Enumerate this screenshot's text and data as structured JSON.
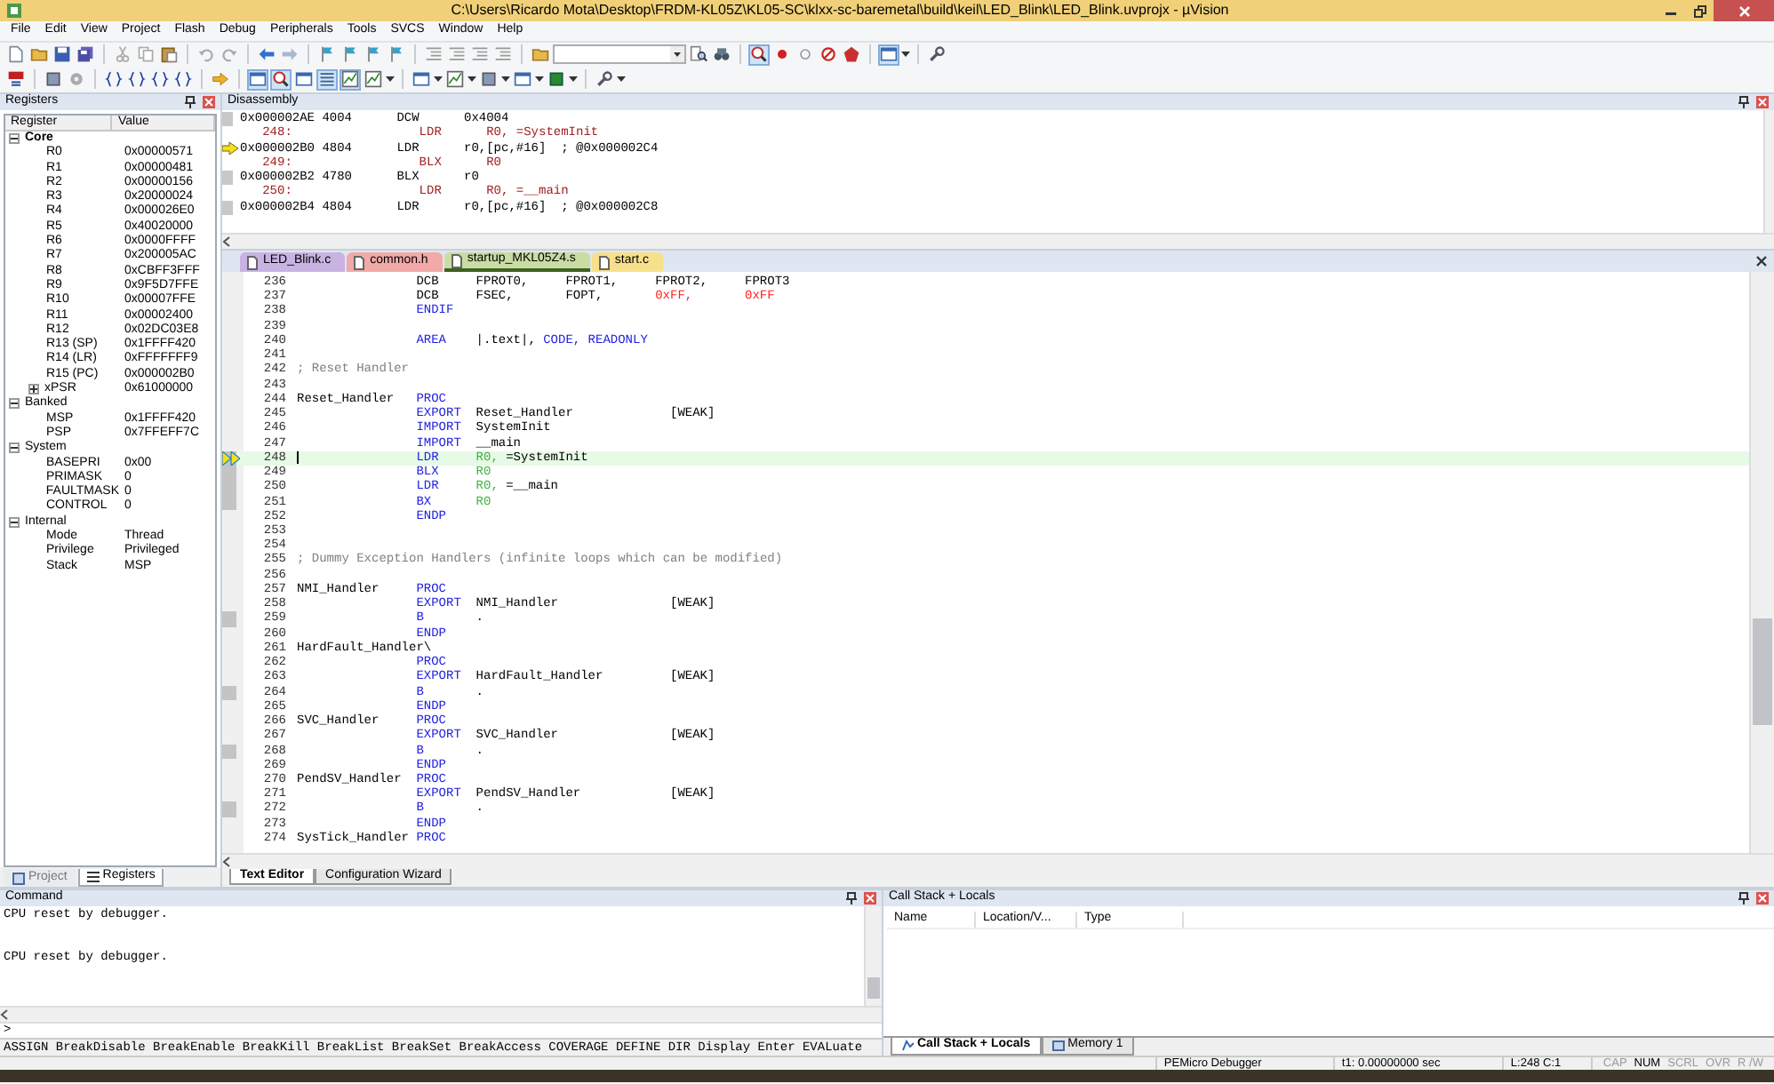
{
  "window": {
    "title": "C:\\Users\\Ricardo Mota\\Desktop\\FRDM-KL05Z\\KL05-SC\\klxx-sc-baremetal\\build\\keil\\LED_Blink\\LED_Blink.uvprojx - µVision"
  },
  "menu": [
    "File",
    "Edit",
    "View",
    "Project",
    "Flash",
    "Debug",
    "Peripherals",
    "Tools",
    "SVCS",
    "Window",
    "Help"
  ],
  "toolbars": [
    [
      {
        "kind": "document",
        "pressed": false
      },
      {
        "kind": "folder",
        "pressed": false
      },
      {
        "kind": "disk",
        "pressed": false
      },
      {
        "kind": "disks",
        "pressed": false
      },
      {
        "kind": "sep"
      },
      {
        "kind": "scissors",
        "pressed": false
      },
      {
        "kind": "copy",
        "pressed": false
      },
      {
        "kind": "paste",
        "pressed": false
      },
      {
        "kind": "sep"
      },
      {
        "kind": "undo",
        "pressed": false
      },
      {
        "kind": "redo",
        "pressed": false
      },
      {
        "kind": "sep"
      },
      {
        "kind": "back",
        "pressed": false
      },
      {
        "kind": "forward",
        "pressed": false
      },
      {
        "kind": "sep"
      },
      {
        "kind": "flag",
        "pressed": false
      },
      {
        "kind": "flag",
        "pressed": false
      },
      {
        "kind": "flag",
        "pressed": false
      },
      {
        "kind": "flag",
        "pressed": false
      },
      {
        "kind": "sep"
      },
      {
        "kind": "indent",
        "pressed": false
      },
      {
        "kind": "indent",
        "pressed": false
      },
      {
        "kind": "indent",
        "pressed": false
      },
      {
        "kind": "indent",
        "pressed": false
      },
      {
        "kind": "sep"
      },
      {
        "kind": "folder",
        "pressed": false
      },
      {
        "kind": "combo"
      },
      {
        "kind": "find",
        "pressed": false
      },
      {
        "kind": "binoculars",
        "pressed": false
      },
      {
        "kind": "sep"
      },
      {
        "kind": "magnifier",
        "pressed": true
      },
      {
        "kind": "dot",
        "pressed": false
      },
      {
        "kind": "circle",
        "pressed": false
      },
      {
        "kind": "crossed",
        "pressed": false
      },
      {
        "kind": "polygon",
        "pressed": false
      },
      {
        "kind": "sep"
      },
      {
        "kind": "window",
        "pressed": true
      },
      {
        "kind": "caret"
      },
      {
        "kind": "sep"
      },
      {
        "kind": "wrench",
        "pressed": false
      }
    ],
    [
      {
        "kind": "reset",
        "pressed": false
      },
      {
        "kind": "sep"
      },
      {
        "kind": "chip",
        "pressed": false
      },
      {
        "kind": "gear",
        "pressed": false
      },
      {
        "kind": "sep"
      },
      {
        "kind": "braces",
        "pressed": false
      },
      {
        "kind": "braces",
        "pressed": false
      },
      {
        "kind": "braces",
        "pressed": false
      },
      {
        "kind": "braces",
        "pressed": false
      },
      {
        "kind": "sep"
      },
      {
        "kind": "arrow",
        "pressed": false
      },
      {
        "kind": "sep"
      },
      {
        "kind": "window",
        "pressed": true
      },
      {
        "kind": "magnifier",
        "pressed": true
      },
      {
        "kind": "window",
        "pressed": false
      },
      {
        "kind": "list",
        "pressed": true
      },
      {
        "kind": "chart",
        "pressed": true
      },
      {
        "kind": "chart",
        "pressed": false
      },
      {
        "kind": "caret"
      },
      {
        "kind": "sep"
      },
      {
        "kind": "window",
        "pressed": false
      },
      {
        "kind": "caret"
      },
      {
        "kind": "chart",
        "pressed": false
      },
      {
        "kind": "caret"
      },
      {
        "kind": "chip",
        "pressed": false
      },
      {
        "kind": "caret"
      },
      {
        "kind": "window",
        "pressed": false
      },
      {
        "kind": "caret"
      },
      {
        "kind": "square",
        "pressed": false
      },
      {
        "kind": "caret"
      },
      {
        "kind": "sep"
      },
      {
        "kind": "wrench",
        "pressed": false
      },
      {
        "kind": "caret"
      }
    ]
  ],
  "registers": {
    "title": "Registers",
    "columns": [
      "Register",
      "Value"
    ],
    "items": [
      {
        "name": "Core",
        "bold": true,
        "expanded": true,
        "children": [
          {
            "name": "R0",
            "value": "0x00000571"
          },
          {
            "name": "R1",
            "value": "0x00000481"
          },
          {
            "name": "R2",
            "value": "0x00000156"
          },
          {
            "name": "R3",
            "value": "0x20000024"
          },
          {
            "name": "R4",
            "value": "0x000026E0"
          },
          {
            "name": "R5",
            "value": "0x40020000"
          },
          {
            "name": "R6",
            "value": "0x0000FFFF"
          },
          {
            "name": "R7",
            "value": "0x200005AC"
          },
          {
            "name": "R8",
            "value": "0xCBFF3FFF"
          },
          {
            "name": "R9",
            "value": "0x9F5D7FFE"
          },
          {
            "name": "R10",
            "value": "0x00007FFE"
          },
          {
            "name": "R11",
            "value": "0x00002400"
          },
          {
            "name": "R12",
            "value": "0x02DC03E8"
          },
          {
            "name": "R13 (SP)",
            "value": "0x1FFFF420"
          },
          {
            "name": "R14 (LR)",
            "value": "0xFFFFFFF9"
          },
          {
            "name": "R15 (PC)",
            "value": "0x000002B0"
          },
          {
            "name": "xPSR",
            "value": "0x61000000",
            "expanded": false
          }
        ]
      },
      {
        "name": "Banked",
        "bold": false,
        "expanded": true,
        "children": [
          {
            "name": "MSP",
            "value": "0x1FFFF420"
          },
          {
            "name": "PSP",
            "value": "0x7FFEFF7C"
          }
        ]
      },
      {
        "name": "System",
        "bold": false,
        "expanded": true,
        "children": [
          {
            "name": "BASEPRI",
            "value": "0x00"
          },
          {
            "name": "PRIMASK",
            "value": "0"
          },
          {
            "name": "FAULTMASK",
            "value": "0"
          },
          {
            "name": "CONTROL",
            "value": "0"
          }
        ]
      },
      {
        "name": "Internal",
        "bold": false,
        "expanded": true,
        "children": [
          {
            "name": "Mode",
            "value": "Thread"
          },
          {
            "name": "Privilege",
            "value": "Privileged"
          },
          {
            "name": "Stack",
            "value": "MSP"
          }
        ]
      }
    ],
    "tabs": [
      {
        "label": "Project",
        "selected": false
      },
      {
        "label": "Registers",
        "selected": true
      }
    ]
  },
  "disassembly": {
    "title": "Disassembly",
    "lines": [
      {
        "kind": "asm",
        "address": "0x000002AE",
        "code": "4004",
        "op": "DCW",
        "args": "0x4004",
        "current": false
      },
      {
        "kind": "src",
        "number": "248:",
        "op": "LDR",
        "args": "R0, =SystemInit"
      },
      {
        "kind": "asm",
        "address": "0x000002B0",
        "code": "4804",
        "op": "LDR",
        "args": "r0,[pc,#16]",
        "comment": "; @0x000002C4",
        "current": true
      },
      {
        "kind": "src",
        "number": "249:",
        "op": "BLX",
        "args": "R0"
      },
      {
        "kind": "asm",
        "address": "0x000002B2",
        "code": "4780",
        "op": "BLX",
        "args": "r0",
        "current": false
      },
      {
        "kind": "src",
        "number": "250:",
        "op": "LDR",
        "args": "R0, =__main"
      },
      {
        "kind": "asm",
        "address": "0x000002B4",
        "code": "4804",
        "op": "LDR",
        "args": "r0,[pc,#16]",
        "comment": "; @0x000002C8",
        "current": false
      }
    ]
  },
  "editor": {
    "tabs": [
      {
        "label": "LED_Blink.c",
        "color": "#c9b3e3",
        "selected": false
      },
      {
        "label": "common.h",
        "color": "#f2aaa8",
        "selected": false
      },
      {
        "label": "startup_MKL05Z4.s",
        "color": "#c9dca3",
        "selected": true
      },
      {
        "label": "start.c",
        "color": "#f7e08c",
        "selected": false
      }
    ],
    "lines": [
      {
        "n": "236",
        "op": {
          "text": "DCB",
          "kind": "plain"
        },
        "args": [
          [
            {
              "text": "FPROT0,",
              "kind": "plain"
            }
          ],
          [
            {
              "text": "FPROT1,",
              "kind": "plain"
            }
          ],
          [
            {
              "text": "FPROT2,",
              "kind": "plain"
            }
          ],
          [
            {
              "text": "FPROT3",
              "kind": "plain"
            }
          ]
        ],
        "covered": false,
        "current": false
      },
      {
        "n": "237",
        "op": {
          "text": "DCB",
          "kind": "plain"
        },
        "args": [
          [
            {
              "text": "FSEC,",
              "kind": "plain"
            }
          ],
          [
            {
              "text": "FOPT,",
              "kind": "plain"
            }
          ],
          [
            {
              "text": "0xFF,",
              "kind": "num"
            }
          ],
          [
            {
              "text": "0xFF",
              "kind": "num"
            }
          ]
        ],
        "covered": false,
        "current": false
      },
      {
        "n": "238",
        "op": {
          "text": "ENDIF",
          "kind": "kw"
        },
        "covered": false,
        "current": false
      },
      {
        "n": "239",
        "covered": false,
        "current": false
      },
      {
        "n": "240",
        "op": {
          "text": "AREA",
          "kind": "kw"
        },
        "args": [
          [
            {
              "text": "|.text|,",
              "kind": "plain"
            },
            {
              "text": "CODE,",
              "kind": "kw"
            },
            {
              "text": "READONLY",
              "kind": "kw"
            }
          ]
        ],
        "covered": false,
        "current": false
      },
      {
        "n": "241",
        "covered": false,
        "current": false
      },
      {
        "n": "242",
        "comment": "; Reset Handler",
        "covered": false,
        "current": false
      },
      {
        "n": "243",
        "covered": false,
        "current": false
      },
      {
        "n": "244",
        "label": "Reset_Handler",
        "op": {
          "text": "PROC",
          "kind": "kw"
        },
        "covered": false,
        "current": false
      },
      {
        "n": "245",
        "op": {
          "text": "EXPORT",
          "kind": "kw"
        },
        "args": [
          [
            {
              "text": "Reset_Handler",
              "kind": "plain"
            }
          ],
          [
            {
              "text": "[WEAK]",
              "kind": "plain"
            }
          ]
        ],
        "covered": false,
        "current": false
      },
      {
        "n": "246",
        "op": {
          "text": "IMPORT",
          "kind": "kw"
        },
        "args": [
          [
            {
              "text": "SystemInit",
              "kind": "plain"
            }
          ]
        ],
        "covered": false,
        "current": false
      },
      {
        "n": "247",
        "op": {
          "text": "IMPORT",
          "kind": "kw"
        },
        "args": [
          [
            {
              "text": "__main",
              "kind": "plain"
            }
          ]
        ],
        "covered": false,
        "current": false
      },
      {
        "n": "248",
        "op": {
          "text": "LDR",
          "kind": "kw"
        },
        "args": [
          [
            {
              "text": "R0,",
              "kind": "reg"
            },
            {
              "text": "=SystemInit",
              "kind": "plain"
            }
          ]
        ],
        "covered": true,
        "current": true
      },
      {
        "n": "249",
        "op": {
          "text": "BLX",
          "kind": "kw"
        },
        "args": [
          [
            {
              "text": "R0",
              "kind": "reg"
            }
          ]
        ],
        "covered": true,
        "current": false
      },
      {
        "n": "250",
        "op": {
          "text": "LDR",
          "kind": "kw"
        },
        "args": [
          [
            {
              "text": "R0,",
              "kind": "reg"
            },
            {
              "text": "=__main",
              "kind": "plain"
            }
          ]
        ],
        "covered": true,
        "current": false
      },
      {
        "n": "251",
        "op": {
          "text": "BX",
          "kind": "kw"
        },
        "args": [
          [
            {
              "text": "R0",
              "kind": "reg"
            }
          ]
        ],
        "covered": true,
        "current": false
      },
      {
        "n": "252",
        "op": {
          "text": "ENDP",
          "kind": "kw"
        },
        "covered": false,
        "current": false
      },
      {
        "n": "253",
        "covered": false,
        "current": false
      },
      {
        "n": "254",
        "covered": false,
        "current": false
      },
      {
        "n": "255",
        "comment": "; Dummy Exception Handlers (infinite loops which can be modified)",
        "covered": false,
        "current": false
      },
      {
        "n": "256",
        "covered": false,
        "current": false
      },
      {
        "n": "257",
        "label": "NMI_Handler",
        "op": {
          "text": "PROC",
          "kind": "kw"
        },
        "covered": false,
        "current": false
      },
      {
        "n": "258",
        "op": {
          "text": "EXPORT",
          "kind": "kw"
        },
        "args": [
          [
            {
              "text": "NMI_Handler",
              "kind": "plain"
            }
          ],
          [
            {
              "text": "[WEAK]",
              "kind": "plain"
            }
          ]
        ],
        "covered": false,
        "current": false
      },
      {
        "n": "259",
        "op": {
          "text": "B",
          "kind": "kw"
        },
        "args": [
          [
            {
              "text": ".",
              "kind": "plain"
            }
          ]
        ],
        "covered": true,
        "current": false
      },
      {
        "n": "260",
        "op": {
          "text": "ENDP",
          "kind": "kw"
        },
        "covered": false,
        "current": false
      },
      {
        "n": "261",
        "label": "HardFault_Handler\\",
        "covered": false,
        "current": false
      },
      {
        "n": "262",
        "op": {
          "text": "PROC",
          "kind": "kw"
        },
        "covered": false,
        "current": false
      },
      {
        "n": "263",
        "op": {
          "text": "EXPORT",
          "kind": "kw"
        },
        "args": [
          [
            {
              "text": "HardFault_Handler",
              "kind": "plain"
            }
          ],
          [
            {
              "text": "[WEAK]",
              "kind": "plain"
            }
          ]
        ],
        "covered": false,
        "current": false
      },
      {
        "n": "264",
        "op": {
          "text": "B",
          "kind": "kw"
        },
        "args": [
          [
            {
              "text": ".",
              "kind": "plain"
            }
          ]
        ],
        "covered": true,
        "current": false
      },
      {
        "n": "265",
        "op": {
          "text": "ENDP",
          "kind": "kw"
        },
        "covered": false,
        "current": false
      },
      {
        "n": "266",
        "label": "SVC_Handler",
        "op": {
          "text": "PROC",
          "kind": "kw"
        },
        "covered": false,
        "current": false
      },
      {
        "n": "267",
        "op": {
          "text": "EXPORT",
          "kind": "kw"
        },
        "args": [
          [
            {
              "text": "SVC_Handler",
              "kind": "plain"
            }
          ],
          [
            {
              "text": "[WEAK]",
              "kind": "plain"
            }
          ]
        ],
        "covered": false,
        "current": false
      },
      {
        "n": "268",
        "op": {
          "text": "B",
          "kind": "kw"
        },
        "args": [
          [
            {
              "text": ".",
              "kind": "plain"
            }
          ]
        ],
        "covered": true,
        "current": false
      },
      {
        "n": "269",
        "op": {
          "text": "ENDP",
          "kind": "kw"
        },
        "covered": false,
        "current": false
      },
      {
        "n": "270",
        "label": "PendSV_Handler",
        "op": {
          "text": "PROC",
          "kind": "kw"
        },
        "covered": false,
        "current": false
      },
      {
        "n": "271",
        "op": {
          "text": "EXPORT",
          "kind": "kw"
        },
        "args": [
          [
            {
              "text": "PendSV_Handler",
              "kind": "plain"
            }
          ],
          [
            {
              "text": "[WEAK]",
              "kind": "plain"
            }
          ]
        ],
        "covered": false,
        "current": false
      },
      {
        "n": "272",
        "op": {
          "text": "B",
          "kind": "kw"
        },
        "args": [
          [
            {
              "text": ".",
              "kind": "plain"
            }
          ]
        ],
        "covered": true,
        "current": false
      },
      {
        "n": "273",
        "op": {
          "text": "ENDP",
          "kind": "kw"
        },
        "covered": false,
        "current": false
      },
      {
        "n": "274",
        "label": "SysTick_Handler",
        "op": {
          "text": "PROC",
          "kind": "kw"
        },
        "covered": false,
        "current": false
      }
    ],
    "bottom_tabs": [
      {
        "label": "Text Editor",
        "selected": true
      },
      {
        "label": "Configuration Wizard",
        "selected": false
      }
    ]
  },
  "command": {
    "title": "Command",
    "output": [
      "CPU reset by debugger.",
      "CPU reset by debugger."
    ],
    "prompt": ">",
    "hint": "ASSIGN BreakDisable BreakEnable BreakKill BreakList BreakSet BreakAccess COVERAGE DEFINE DIR Display Enter EVALuate"
  },
  "call_stack": {
    "title": "Call Stack + Locals",
    "columns": [
      "Name",
      "Location/V...",
      "Type"
    ],
    "tabs": [
      {
        "label": "Call Stack + Locals",
        "selected": true
      },
      {
        "label": "Memory 1",
        "selected": false
      }
    ]
  },
  "status_bar": {
    "debugger": "PEMicro Debugger",
    "time": "t1: 0.00000000 sec",
    "position": "L:248 C:1",
    "indicators": [
      {
        "label": "CAP",
        "on": false
      },
      {
        "label": "NUM",
        "on": true
      },
      {
        "label": "SCRL",
        "on": false
      },
      {
        "label": "OVR",
        "on": false
      },
      {
        "label": "R /W",
        "on": false
      }
    ]
  }
}
